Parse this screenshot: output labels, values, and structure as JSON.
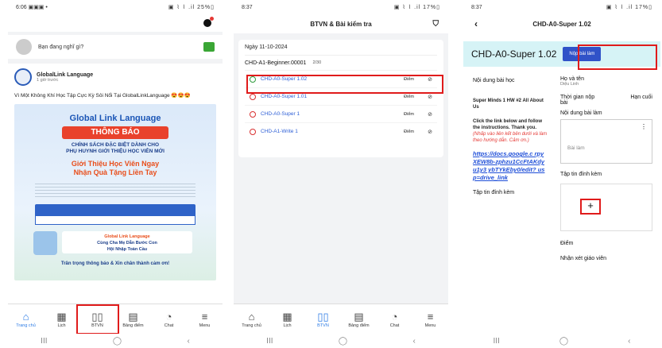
{
  "p1": {
    "time": "6:06",
    "status_icons": "▣▣▣ •",
    "status_right": "▣ ⌇ ⌇ .il 25%▯",
    "post_placeholder": "Bạn đang nghĩ gì?",
    "feed_author": "GlobalLink Language",
    "feed_time": "1 giờ trước",
    "feed_text": "Vì Một Không Khí Học Tập Cực Kỳ Sôi Nổi Tại GlobalLinkLanguage 😍😍😍",
    "poster": {
      "brand": "Global Link Language",
      "headline": "THÔNG BÁO",
      "line1a": "CHÍNH SÁCH ĐẶC BIỆT DÀNH CHO",
      "line1b": "PHỤ HUYNH GIỚI THIỆU HỌC VIÊN MỚI",
      "line2a": "Giới Thiệu Học Viên Ngay",
      "line2b": "Nhận Quà Tặng Liền Tay",
      "band1": "Global Link Language",
      "band2": "Cùng Cha Mẹ Dẫn Bước Con",
      "band3": "Hội Nhập Toàn Cầu",
      "thanks": "Trân trọng thông báo & Xin chân thành cảm ơn!"
    },
    "tabs": [
      {
        "icon": "⌂",
        "label": "Trang chủ"
      },
      {
        "icon": "▦",
        "label": "Lịch"
      },
      {
        "icon": "▯▯",
        "label": "BTVN"
      },
      {
        "icon": "▤",
        "label": "Bảng điểm"
      },
      {
        "icon": "◔",
        "label": "Chat"
      },
      {
        "icon": "≡",
        "label": "Menu"
      }
    ]
  },
  "p2": {
    "time": "8:37",
    "status_right": "▣ ⌇ ⌇ .il 17%▯",
    "title": "BTVN & Bài kiểm tra",
    "filter_icon": "⛉",
    "date": "Ngày 11-10-2024",
    "class_name": "CHD-A1-Beginner.00001",
    "class_count": "2/30",
    "homework": [
      {
        "name": "CHD-A0-Super 1.02",
        "score": "Điểm",
        "done": true
      },
      {
        "name": "CHD-A0-Super 1.01",
        "score": "Điểm",
        "done": false
      },
      {
        "name": "CHD-A0-Super 1",
        "score": "Điểm",
        "done": false
      },
      {
        "name": "CHD-A1-Write 1",
        "score": "Điểm",
        "done": false
      }
    ],
    "eye_icon": "⊘",
    "tabs": [
      {
        "icon": "⌂",
        "label": "Trang chủ"
      },
      {
        "icon": "▦",
        "label": "Lịch"
      },
      {
        "icon": "▯▯",
        "label": "BTVN"
      },
      {
        "icon": "▤",
        "label": "Bảng điểm"
      },
      {
        "icon": "◔",
        "label": "Chat"
      },
      {
        "icon": "≡",
        "label": "Menu"
      }
    ]
  },
  "p3": {
    "time": "8:37",
    "status_right": "▣ ⌇ ⌇ .il 17%▯",
    "header_title": "CHD-A0-Super 1.02",
    "back_icon": "‹",
    "title": "CHD-A0-Super 1.02",
    "submit_label": "Nộp bài làm",
    "content_label": "Nội dung bài học",
    "lesson_title": "Super Minds 1 HW #2 All About Us",
    "instructions": "Click the link below and follow the instructions. Thank you.",
    "instructions_vi": "(Nhấp vào liên kết bên dưới và làm theo hướng dẫn. Cảm ơn.)",
    "link": "https://docs.google.com/forms/d/e/1FAIpQLSe-rpyXEW8b-zphzu1CcFtAKdyu1y3ybTYkEby0/edit?usp=drive_link",
    "link_display": "https://docs.google.c rpyXEW8b-zphzu1CcFtAKdyu1y3 ybTYkEby0/edit? usp=drive_link",
    "attach_left": "Tập tin đính kèm",
    "name_label": "Họ và tên",
    "name_value": "Diệu Linh",
    "time_label": "Thời gian nộp bài",
    "deadline_label": "Hạn cuối",
    "work_label": "Nội dung bài làm",
    "work_placeholder": "Bài làm",
    "more_icon": "⋮",
    "attach_right": "Tập tin đính kèm",
    "plus_icon": "+",
    "score_label": "Điểm",
    "review_label": "Nhận xét giáo viên"
  },
  "sysnav": {
    "recent": "III",
    "home": "◯",
    "back": "‹"
  }
}
